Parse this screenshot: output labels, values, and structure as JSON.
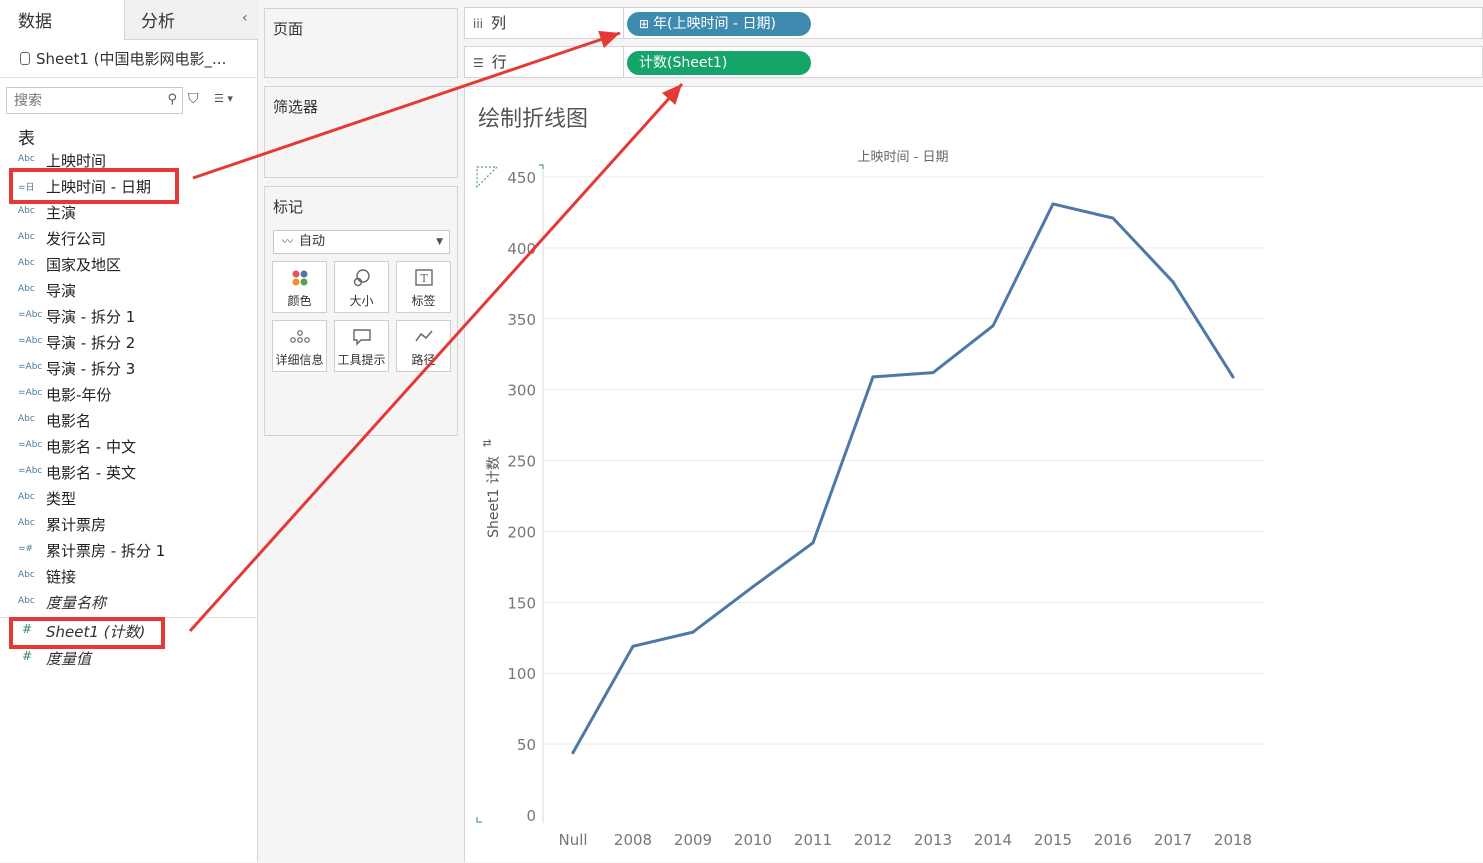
{
  "data_pane": {
    "tab_data": "数据",
    "tab_analysis": "分析",
    "collapse": "‹",
    "datasource": "Sheet1 (中国电影网电影_...",
    "search_placeholder": "搜索",
    "section_table": "表",
    "fields": [
      {
        "icon": "Abc",
        "label": "上映时间"
      },
      {
        "icon": "=日",
        "label": "上映时间 - 日期"
      },
      {
        "icon": "Abc",
        "label": "主演"
      },
      {
        "icon": "Abc",
        "label": "发行公司"
      },
      {
        "icon": "Abc",
        "label": "国家及地区"
      },
      {
        "icon": "Abc",
        "label": "导演"
      },
      {
        "icon": "=Abc",
        "label": "导演 - 拆分 1"
      },
      {
        "icon": "=Abc",
        "label": "导演 - 拆分 2"
      },
      {
        "icon": "=Abc",
        "label": "导演 - 拆分 3"
      },
      {
        "icon": "=Abc",
        "label": "电影-年份"
      },
      {
        "icon": "Abc",
        "label": "电影名"
      },
      {
        "icon": "=Abc",
        "label": "电影名 - 中文"
      },
      {
        "icon": "=Abc",
        "label": "电影名 - 英文"
      },
      {
        "icon": "Abc",
        "label": "类型"
      },
      {
        "icon": "Abc",
        "label": "累计票房"
      },
      {
        "icon": "=#",
        "label": "累计票房 - 拆分 1"
      },
      {
        "icon": "Abc",
        "label": "链接"
      },
      {
        "icon": "Abc",
        "label": "度量名称"
      }
    ],
    "measures": [
      {
        "icon": "#",
        "label": "Sheet1 (计数)"
      },
      {
        "icon": "#",
        "label": "度量值"
      }
    ]
  },
  "cards": {
    "pages": "页面",
    "filters": "筛选器",
    "marks": "标记",
    "mark_type": "自动",
    "mark_buttons": [
      {
        "label": "颜色",
        "icon": "color-icon"
      },
      {
        "label": "大小",
        "icon": "size-icon"
      },
      {
        "label": "标签",
        "icon": "label-icon"
      },
      {
        "label": "详细信息",
        "icon": "detail-icon"
      },
      {
        "label": "工具提示",
        "icon": "tooltip-icon"
      },
      {
        "label": "路径",
        "icon": "path-icon"
      }
    ]
  },
  "shelves": {
    "columns_label": "列",
    "rows_label": "行",
    "columns_pill": "年(上映时间 - 日期)",
    "rows_pill": "计数(Sheet1)",
    "columns_pill_color": "#3f8bb0",
    "rows_pill_color": "#15a46a"
  },
  "view": {
    "sheet_title": "绘制折线图"
  },
  "chart_data": {
    "type": "line",
    "title": "上映时间 - 日期",
    "xlabel": "",
    "ylabel": "Sheet1 计数",
    "categories": [
      "Null",
      "2008",
      "2009",
      "2010",
      "2011",
      "2012",
      "2013",
      "2014",
      "2015",
      "2016",
      "2017",
      "2018"
    ],
    "series": [
      {
        "name": "",
        "values": [
          44,
          119,
          129,
          161,
          192,
          309,
          312,
          345,
          431,
          421,
          376,
          309
        ],
        "color": "#4e79a7"
      }
    ],
    "ylim": [
      0,
      450
    ],
    "yticks": [
      0,
      50,
      100,
      150,
      200,
      250,
      300,
      350,
      400,
      450
    ],
    "grid": true
  },
  "annotation_color": "#e53935"
}
